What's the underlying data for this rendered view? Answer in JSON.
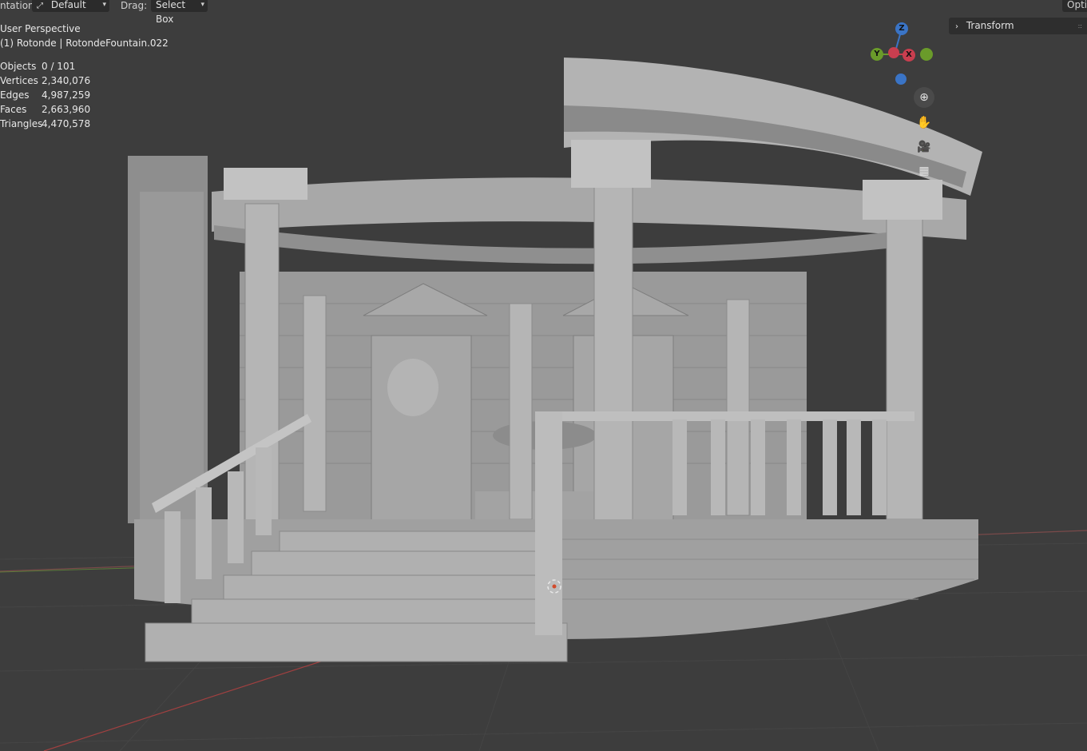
{
  "header": {
    "orientation_label": "ntation:",
    "orientation_value": "Default",
    "drag_label": "Drag:",
    "drag_value": "Select Box",
    "options_label": "Optio"
  },
  "overlay": {
    "view_name": "User Perspective",
    "object_path": "(1) Rotonde | RotondeFountain.022",
    "stats": [
      {
        "label": "Objects",
        "value": "0 / 101"
      },
      {
        "label": "Vertices",
        "value": "2,340,076"
      },
      {
        "label": "Edges",
        "value": "4,987,259"
      },
      {
        "label": "Faces",
        "value": "2,663,960"
      },
      {
        "label": "Triangles",
        "value": "4,470,578"
      }
    ]
  },
  "gizmo": {
    "z_label": "Z",
    "y_label": "Y",
    "x_label": "X",
    "colors": {
      "x": "#c93e4f",
      "y": "#6a9b2a",
      "z": "#3a74c6"
    }
  },
  "nav_tools": {
    "zoom_icon": "zoom-in-icon",
    "pan_icon": "hand-icon",
    "camera_icon": "camera-icon",
    "ortho_icon": "grid-ortho-icon"
  },
  "sidebar": {
    "transform_label": "Transform"
  },
  "scene": {
    "description_icon": "3d-rotunda-model"
  }
}
